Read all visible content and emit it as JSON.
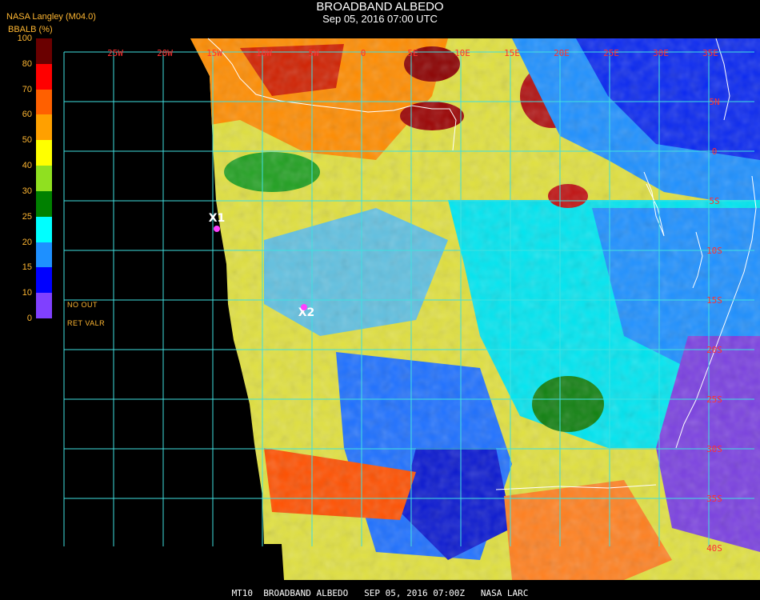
{
  "header": {
    "title": "BROADBAND ALBEDO",
    "subtitle": "Sep 05, 2016 07:00 UTC",
    "source": "NASA Langley (M04.0)"
  },
  "colorbar": {
    "title": "BBALB (%)",
    "ticks": [
      "100",
      "80",
      "70",
      "60",
      "50",
      "40",
      "30",
      "25",
      "20",
      "15",
      "10",
      "0"
    ],
    "colors": [
      "#6a0000",
      "#ff0000",
      "#ff6000",
      "#ffa000",
      "#ffff00",
      "#90e020",
      "#008000",
      "#00ffff",
      "#1e90ff",
      "#0000ff",
      "#8040ff"
    ],
    "note_line1": "NO   OUT",
    "note_line2": "RET  VALR"
  },
  "map": {
    "grid_color": "#40e0e0",
    "lon_labels": [
      "25W",
      "20W",
      "15W",
      "10W",
      "5W",
      "0",
      "5E",
      "10E",
      "15E",
      "20E",
      "25E",
      "30E",
      "35E"
    ],
    "lat_labels": [
      "5N",
      "0",
      "5S",
      "10S",
      "15S",
      "20S",
      "25S",
      "30S",
      "35S",
      "40S"
    ],
    "markers": [
      {
        "label": "X1",
        "color": "#ff40ff"
      },
      {
        "label": "X2",
        "color": "#ff40ff"
      }
    ]
  },
  "footer": {
    "text": "MT10  BROADBAND ALBEDO   SEP 05, 2016 07:00Z   NASA LARC"
  }
}
